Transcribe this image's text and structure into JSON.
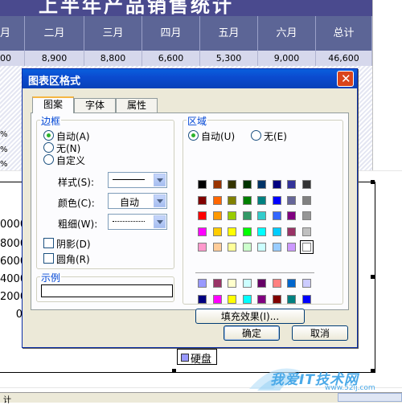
{
  "sheet": {
    "title": "上半年产品销售统计",
    "months": [
      "月",
      "二月",
      "三月",
      "四月",
      "五月",
      "六月",
      "总计"
    ],
    "values": [
      "00",
      "8,900",
      "8,800",
      "6,600",
      "5,300",
      "9,000",
      "46,600"
    ],
    "row_stubs": [
      "%",
      "%",
      "%",
      "%"
    ],
    "y_axis_labels": [
      "0000",
      "8000",
      "6000",
      "4000",
      "2000",
      "0"
    ],
    "legend_label": "硬盘",
    "sheet_tab_label": "计"
  },
  "dialog": {
    "title": "图表区格式",
    "close_symbol": "✕",
    "tabs": [
      {
        "label": "图案",
        "active": true
      },
      {
        "label": "字体",
        "active": false
      },
      {
        "label": "属性",
        "active": false
      }
    ],
    "border": {
      "label": "边框",
      "options": [
        "自动(A)",
        "无(N)",
        "自定义"
      ],
      "selected": "自动(A)",
      "style_label": "样式(S):",
      "color_label": "颜色(C):",
      "color_value": "自动",
      "weight_label": "粗细(W):",
      "shadow_label": "阴影(D)",
      "rounded_label": "圆角(R)"
    },
    "sample_label": "示例",
    "area": {
      "label": "区域",
      "options": [
        "自动(U)",
        "无(E)"
      ],
      "selected": "自动(U)",
      "fill_effects_label": "填充效果(I)...",
      "palette_main": [
        [
          "#000000",
          "#993300",
          "#333300",
          "#003300",
          "#003366",
          "#000080",
          "#333399",
          "#333333"
        ],
        [
          "#800000",
          "#ff6600",
          "#808000",
          "#008000",
          "#008080",
          "#0000ff",
          "#666699",
          "#808080"
        ],
        [
          "#ff0000",
          "#ff9900",
          "#99cc00",
          "#339966",
          "#33cccc",
          "#3366ff",
          "#800080",
          "#969696"
        ],
        [
          "#ff00ff",
          "#ffcc00",
          "#ffff00",
          "#00ff00",
          "#00ffff",
          "#00ccff",
          "#993366",
          "#c0c0c0"
        ],
        [
          "#ff99cc",
          "#ffcc99",
          "#ffff99",
          "#ccffcc",
          "#ccffff",
          "#99ccff",
          "#cc99ff",
          "#ffffff"
        ]
      ],
      "palette_chart": [
        [
          "#9999ff",
          "#993366",
          "#ffffcc",
          "#ccffff",
          "#660066",
          "#ff8080",
          "#0066cc",
          "#ccccff"
        ],
        [
          "#000080",
          "#ff00ff",
          "#ffff00",
          "#00ffff",
          "#800080",
          "#800000",
          "#008080",
          "#0000ff"
        ]
      ]
    },
    "ok_label": "确定",
    "cancel_label": "取消"
  },
  "watermark": {
    "text": "我爱IT技术网",
    "url": "www.52ij.com"
  }
}
